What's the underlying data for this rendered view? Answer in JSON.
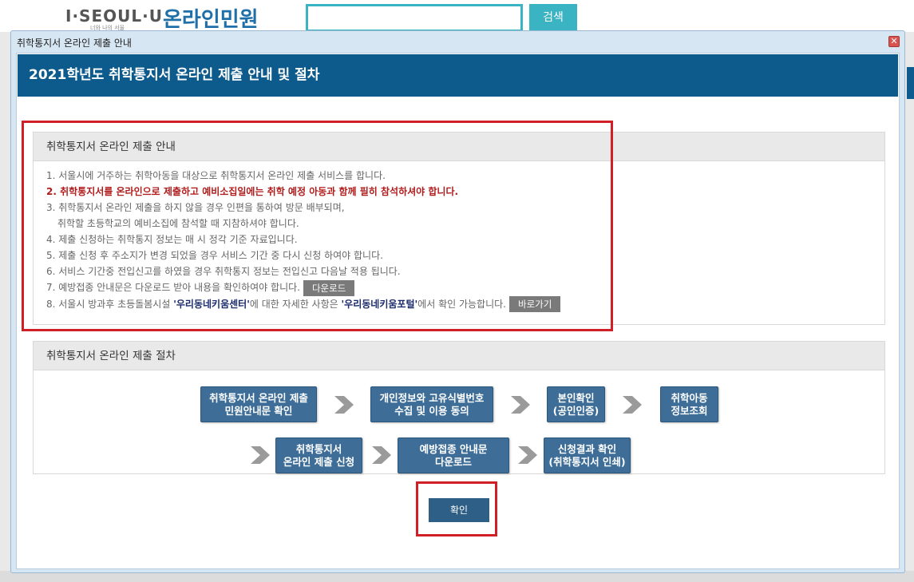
{
  "background": {
    "logo": "I·SEOUL·U",
    "logo_sub": "너와 나의 서울",
    "site_title": "온라인민원",
    "search_button": "검색"
  },
  "dialog": {
    "window_title": "취학통지서 온라인 제출 안내",
    "close_icon": "close-icon",
    "banner_title": "2021학년도 취학통지서 온라인 제출 안내 및 절차",
    "notice": {
      "heading": "취학통지서 온라인 제출 안내",
      "items": [
        "1. 서울시에 거주하는 취학아동을 대상으로 취학통지서 온라인 제출 서비스를 합니다.",
        "2. 취학통지서를 온라인으로 제출하고 예비소집일에는 취학 예정 아동과 함께 필히 참석하셔야 합니다.",
        "3. 취학통지서 온라인 제출을 하지 않을 경우 인편을 통하여 방문 배부되며,",
        "취학할 초등학교의 예비소집에 참석할 때 지참하셔야 합니다.",
        "4. 제출 신청하는 취학통지 정보는 매 시 정각 기준 자료입니다.",
        "5. 제출 신청 후 주소지가 변경 되었을 경우 서비스 기간 중 다시 신청 하여야 합니다.",
        "6. 서비스 기간중 전입신고를 하였을 경우 취학통지 정보는 전입신고 다음날 적용 됩니다.",
        "7. 예방접종 안내문은 다운로드 받아 내용을 확인하여야 합니다."
      ],
      "download_button": "다운로드",
      "item8": {
        "prefix": "8. 서울시 방과후 초등돌봄시설 ",
        "highlight1": "'우리동네키움센터'",
        "middle": "에 대한 자세한 사항은 ",
        "highlight2": "'우리동네키움포털'",
        "suffix": "에서 확인 가능합니다."
      },
      "shortcut_button": "바로가기"
    },
    "procedure": {
      "heading": "취학통지서 온라인 제출 절차",
      "steps": [
        {
          "line1": "취학통지서 온라인 제출",
          "line2": "민원안내문 확인"
        },
        {
          "line1": "개인정보와 고유식별번호",
          "line2": "수집 및 이용 동의"
        },
        {
          "line1": "본인확인",
          "line2": "(공인인증)"
        },
        {
          "line1": "취학아동",
          "line2": "정보조회"
        },
        {
          "line1": "취학통지서",
          "line2": "온라인 제출 신청"
        },
        {
          "line1": "예방접종 안내문",
          "line2": "다운로드"
        },
        {
          "line1": "신청결과 확인",
          "line2": "(취학통지서 인쇄)"
        }
      ],
      "arrow_icon": "chevron-right-icon"
    },
    "confirm_button": "확인",
    "highlight_color": "#d11f27",
    "accent_color": "#0d5a8c"
  }
}
